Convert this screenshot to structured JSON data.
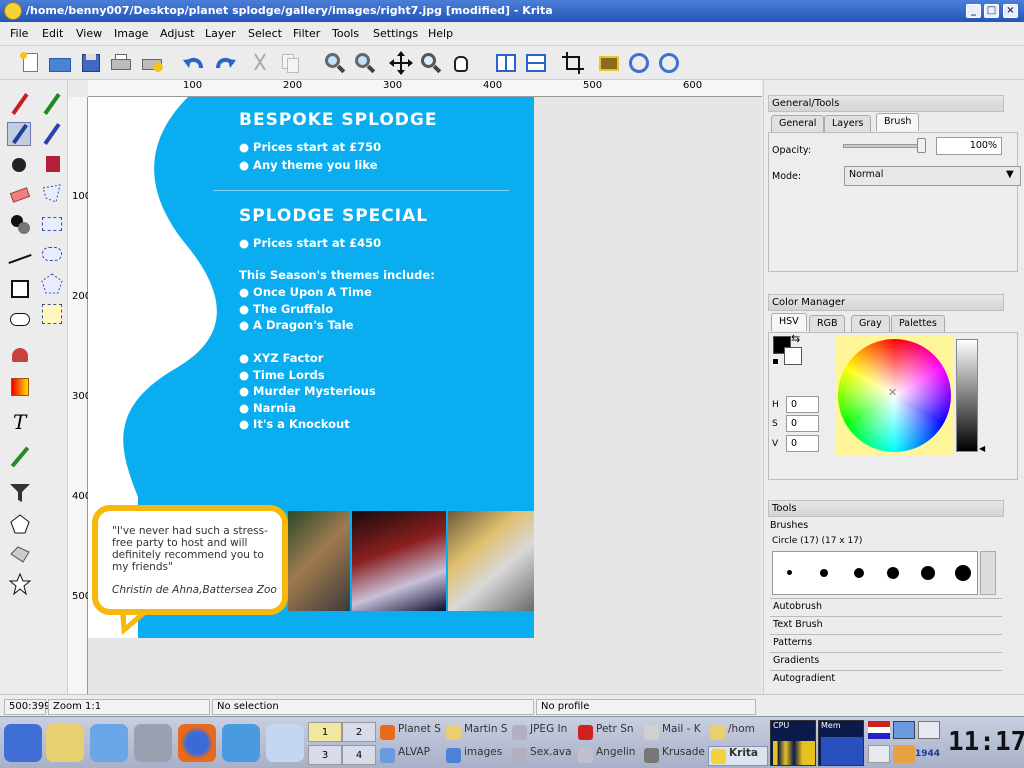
{
  "window": {
    "title": "/home/benny007/Desktop/planet splodge/gallery/images/right7.jpg [modified] - Krita"
  },
  "menu": [
    "File",
    "Edit",
    "View",
    "Image",
    "Adjust",
    "Layer",
    "Select",
    "Filter",
    "Tools",
    "Settings",
    "Help"
  ],
  "ruler": {
    "top": [
      "100",
      "200",
      "300",
      "400",
      "500",
      "600"
    ],
    "left": [
      "100",
      "200",
      "300",
      "400",
      "500"
    ]
  },
  "artwork": {
    "heading1": "BESPOKE SPLODGE",
    "bullets1": [
      "● Prices start at £750",
      "● Any theme you like"
    ],
    "heading2": "SPLODGE SPECIAL",
    "bullet2": "● Prices start at £450",
    "themes_intro": "This Season's themes include:",
    "themes_a": [
      "● Once Upon A Time",
      "● The Gruffalo",
      "● A Dragon's Tale"
    ],
    "themes_b": [
      "● XYZ Factor",
      "● Time Lords",
      "● Murder Mysterious",
      "● Narnia",
      "● It's a Knockout"
    ],
    "quote": "\"I've never had such a stress-free party to host and will definitely recommend you to my friends\"",
    "quote_author": "Christin de Ahna,Battersea Zoo"
  },
  "panel": {
    "general_title": "General/Tools",
    "general_tabs": [
      "General",
      "Layers",
      "Brush"
    ],
    "opacity_label": "Opacity:",
    "opacity_value": "100%",
    "mode_label": "Mode:",
    "mode_value": "Normal",
    "color_title": "Color Manager",
    "color_tabs": [
      "HSV",
      "RGB",
      "Gray",
      "Palettes"
    ],
    "h_label": "H",
    "h_value": "0",
    "s_label": "S",
    "s_value": "0",
    "v_label": "V",
    "v_value": "0",
    "tools_title": "Tools",
    "brushes_title": "Brushes",
    "brush_name": "Circle (17) (17 x 17)",
    "sections": [
      "Autobrush",
      "Text Brush",
      "Patterns",
      "Gradients",
      "Autogradient"
    ]
  },
  "status": {
    "coords": "500:399",
    "zoom": "Zoom 1:1",
    "selection": "No selection",
    "profile": "No profile"
  },
  "taskbar": {
    "desktops": [
      "1",
      "2",
      "3",
      "4"
    ],
    "tasks": [
      "Planet S",
      "Martin S",
      "JPEG In",
      "Petr Sn",
      "Mail - K",
      "/hom",
      "ALVAP",
      "images",
      "Sex.ava",
      "Angelin",
      "Krusade",
      "Krita"
    ],
    "monitor": [
      "CPU",
      "Mem"
    ],
    "tray_num": "1944",
    "clock": "11:17"
  },
  "colors": {
    "accent": "#2454b8",
    "artwork_blue": "#0aaef0",
    "quote_yellow": "#f6b80a"
  }
}
